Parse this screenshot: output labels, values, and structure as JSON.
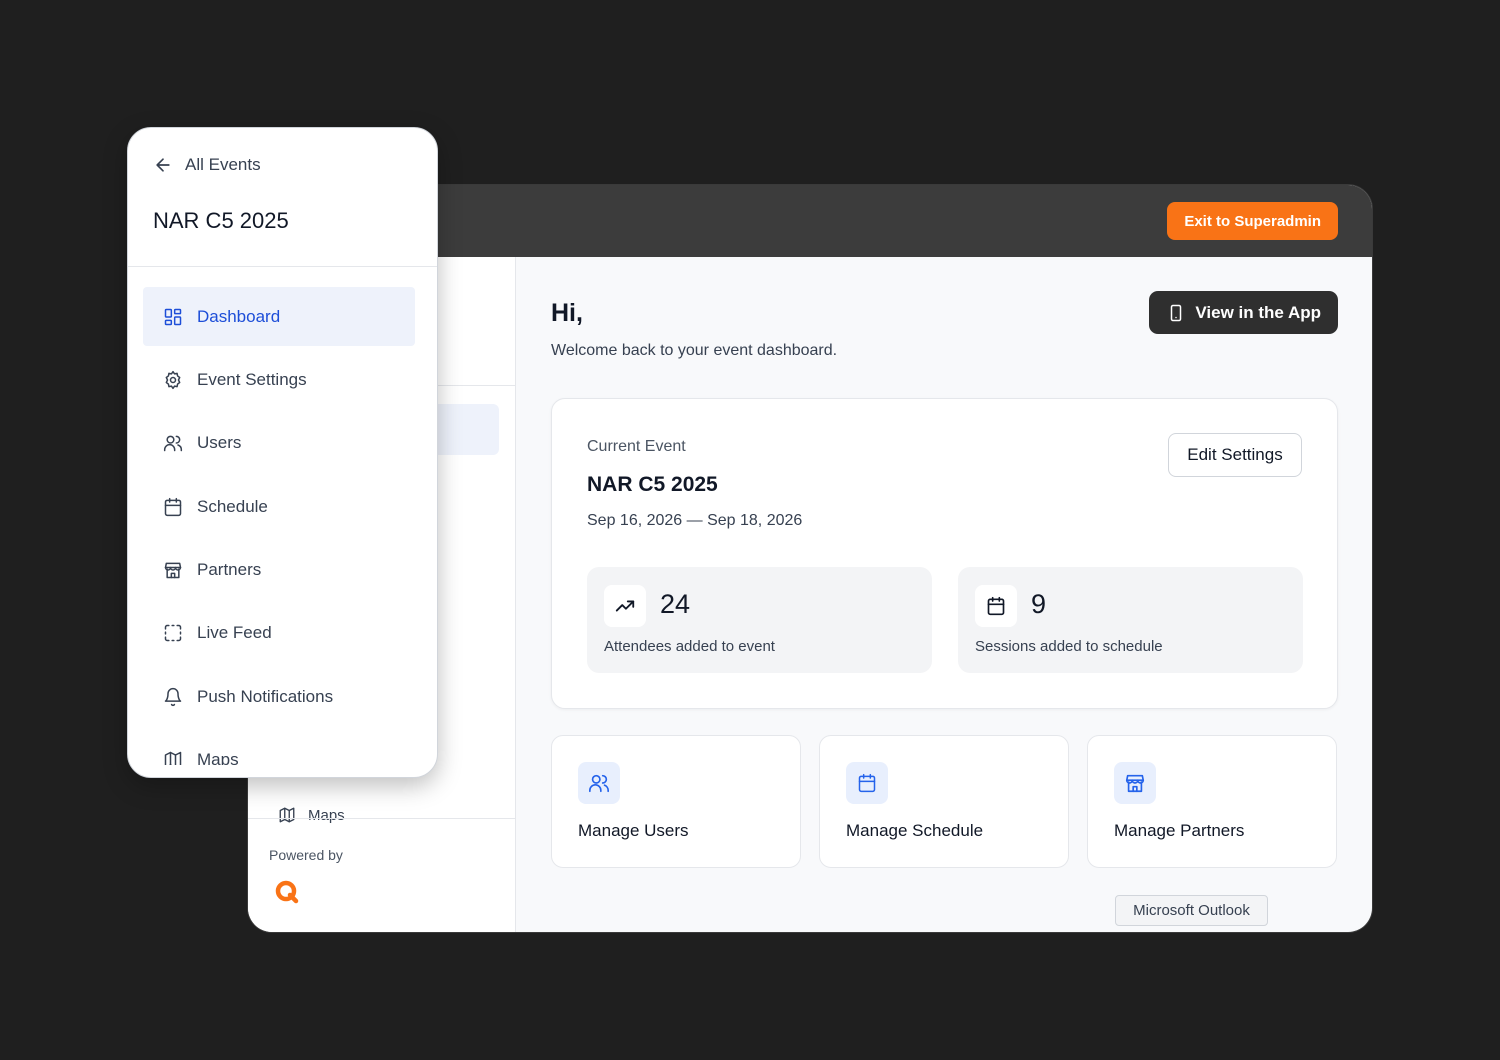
{
  "header": {
    "exit_label": "Exit to Superadmin"
  },
  "sidebar": {
    "back_label": "All Events",
    "event_title": "NAR C5 2025",
    "items": [
      {
        "label": "Dashboard",
        "icon": "dashboard-icon",
        "active": true
      },
      {
        "label": "Event Settings",
        "icon": "gear-icon"
      },
      {
        "label": "Users",
        "icon": "users-icon"
      },
      {
        "label": "Schedule",
        "icon": "calendar-icon"
      },
      {
        "label": "Partners",
        "icon": "store-icon"
      },
      {
        "label": "Live Feed",
        "icon": "feed-icon"
      },
      {
        "label": "Push Notifications",
        "icon": "bell-icon"
      },
      {
        "label": "Maps",
        "icon": "map-icon"
      }
    ],
    "background_maps_label": "Maps",
    "powered_by": "Powered by"
  },
  "main": {
    "greeting": "Hi,",
    "welcome": "Welcome back to your event dashboard.",
    "view_app_label": "View in the App",
    "current_event": {
      "label": "Current Event",
      "name": "NAR C5 2025",
      "dates": "Sep 16, 2026 — Sep 18, 2026",
      "edit_label": "Edit Settings",
      "stats": [
        {
          "value": "24",
          "label": "Attendees added to event",
          "icon": "trending-up-icon"
        },
        {
          "value": "9",
          "label": "Sessions added to schedule",
          "icon": "calendar-icon"
        }
      ]
    },
    "actions": [
      {
        "label": "Manage Users",
        "icon": "users-icon"
      },
      {
        "label": "Manage Schedule",
        "icon": "calendar-icon"
      },
      {
        "label": "Manage Partners",
        "icon": "store-icon"
      }
    ]
  },
  "tooltip": "Microsoft Outlook",
  "colors": {
    "accent": "#f97316",
    "active_blue": "#1d4ed8",
    "active_bg": "#eef2fb",
    "dark_button": "#2f2f2f"
  }
}
